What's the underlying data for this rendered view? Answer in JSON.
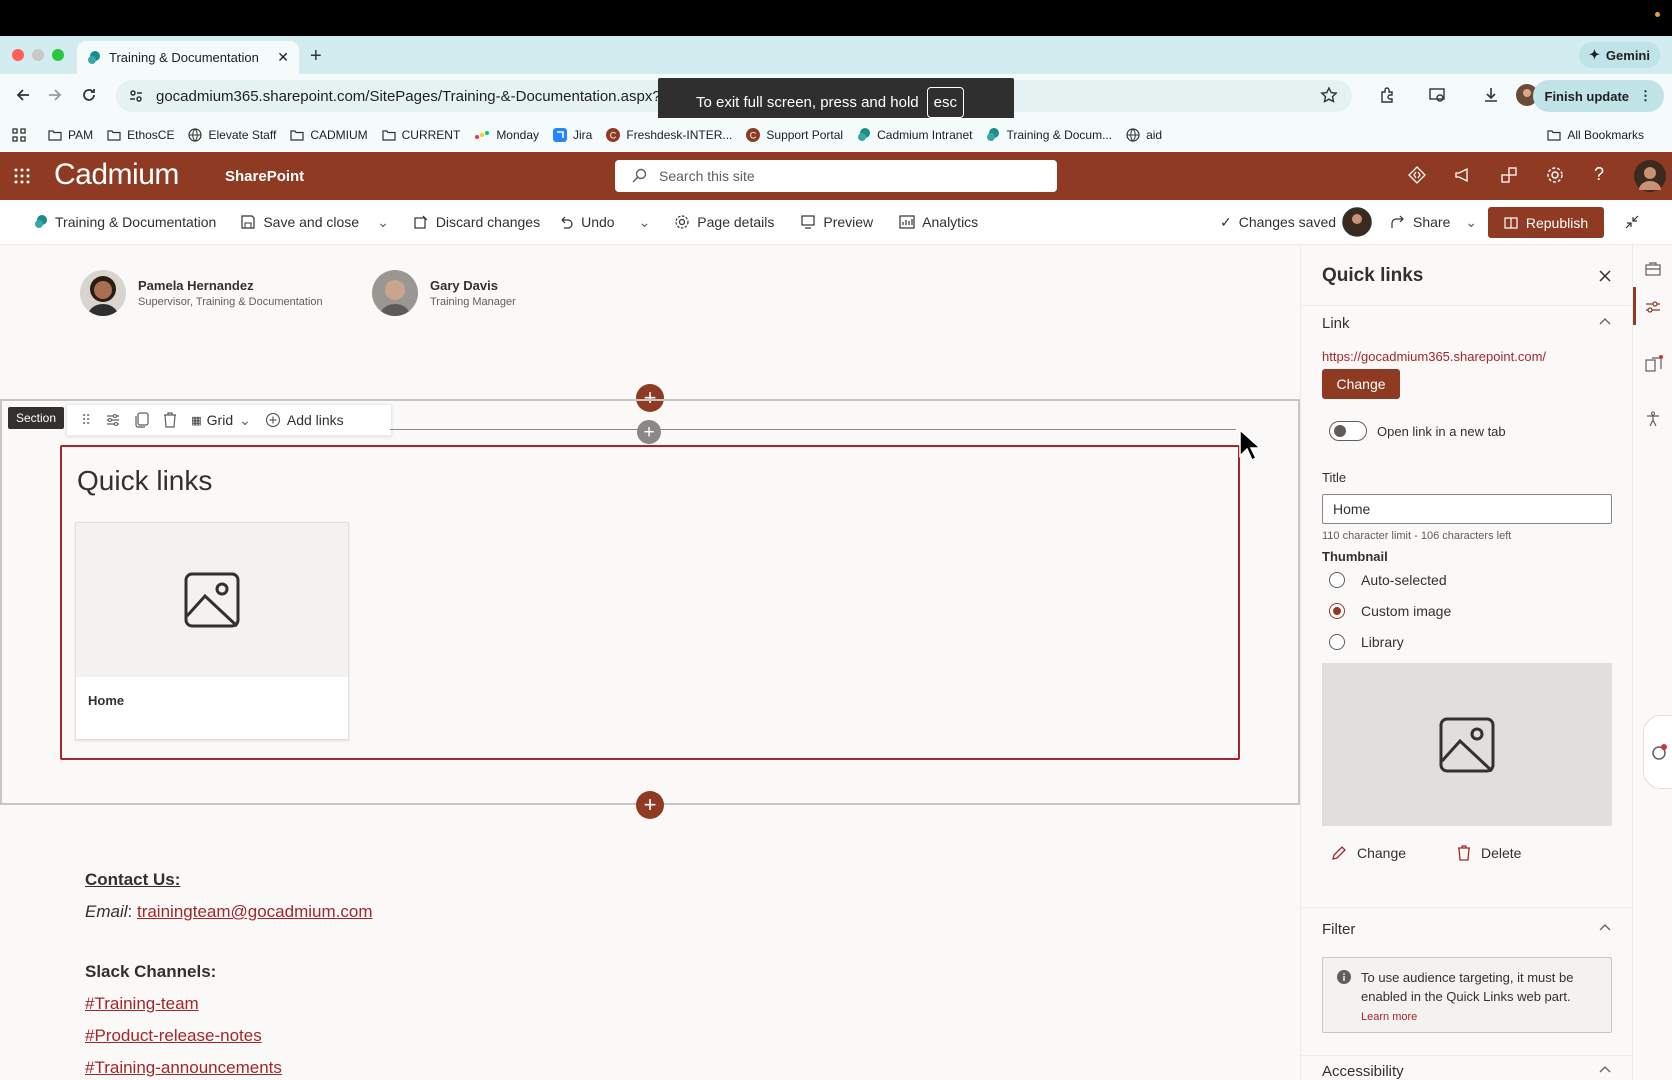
{
  "browser": {
    "tab_title": "Training & Documentation",
    "gemini_label": "Gemini",
    "url": "gocadmium365.sharepoint.com/SitePages/Training-&-Documentation.aspx?Mo",
    "finish_update": "Finish update",
    "fullscreen_message": "To exit full screen, press and hold",
    "fullscreen_key": "esc",
    "bookmarks": [
      {
        "label": "PAM",
        "icon": "folder-icon"
      },
      {
        "label": "EthosCE",
        "icon": "folder-icon"
      },
      {
        "label": "Elevate Staff",
        "icon": "globe-icon"
      },
      {
        "label": "CADMIUM",
        "icon": "folder-icon"
      },
      {
        "label": "CURRENT",
        "icon": "folder-icon"
      },
      {
        "label": "Monday",
        "icon": "monday-icon"
      },
      {
        "label": "Jira",
        "icon": "jira-icon"
      },
      {
        "label": "Freshdesk-INTER...",
        "icon": "cadmium-icon"
      },
      {
        "label": "Support Portal",
        "icon": "cadmium-icon"
      },
      {
        "label": "Cadmium Intranet",
        "icon": "sharepoint-icon"
      },
      {
        "label": "Training & Docum...",
        "icon": "sharepoint-icon"
      },
      {
        "label": "aid",
        "icon": "globe-icon"
      }
    ],
    "all_bookmarks": "All Bookmarks"
  },
  "sharepoint": {
    "brand": "Cadmium",
    "product": "SharePoint",
    "search_placeholder": "Search this site"
  },
  "commandbar": {
    "page_name": "Training & Documentation",
    "save_close": "Save and close",
    "discard": "Discard changes",
    "undo": "Undo",
    "page_details": "Page details",
    "preview": "Preview",
    "analytics": "Analytics",
    "changes_saved": "Changes saved",
    "share": "Share",
    "republish": "Republish"
  },
  "people": [
    {
      "name": "Pamela Hernandez",
      "title": "Supervisor, Training & Documentation"
    },
    {
      "name": "Gary Davis",
      "title": "Training Manager"
    }
  ],
  "section": {
    "tag": "Section",
    "layout": "Grid",
    "add_links": "Add links"
  },
  "quicklinks": {
    "title": "Quick links",
    "card_label": "Home"
  },
  "contact": {
    "heading": "Contact Us:",
    "email_label": "Email",
    "email": "trainingteam@gocadmium.com",
    "slack_heading": "Slack Channels:",
    "channels": [
      "#Training-team",
      "#Product-release-notes",
      "#Training-announcements"
    ]
  },
  "panel": {
    "title": "Quick links",
    "link_section": "Link",
    "link_url": "https://gocadmium365.sharepoint.com/",
    "change_btn": "Change",
    "open_new_tab": "Open link in a new tab",
    "title_label": "Title",
    "title_value": "Home",
    "char_limit": "110 character limit - 106 characters left",
    "thumbnail_label": "Thumbnail",
    "thumb_options": [
      "Auto-selected",
      "Custom image",
      "Library"
    ],
    "thumb_selected": "Custom image",
    "thumb_change": "Change",
    "thumb_delete": "Delete",
    "filter_section": "Filter",
    "filter_info": "To use audience targeting, it must be enabled in the Quick Links web part.",
    "learn_more": "Learn more",
    "accessibility_section": "Accessibility"
  },
  "colors": {
    "brand": "#8f3a22",
    "accent_red": "#a4262c"
  }
}
